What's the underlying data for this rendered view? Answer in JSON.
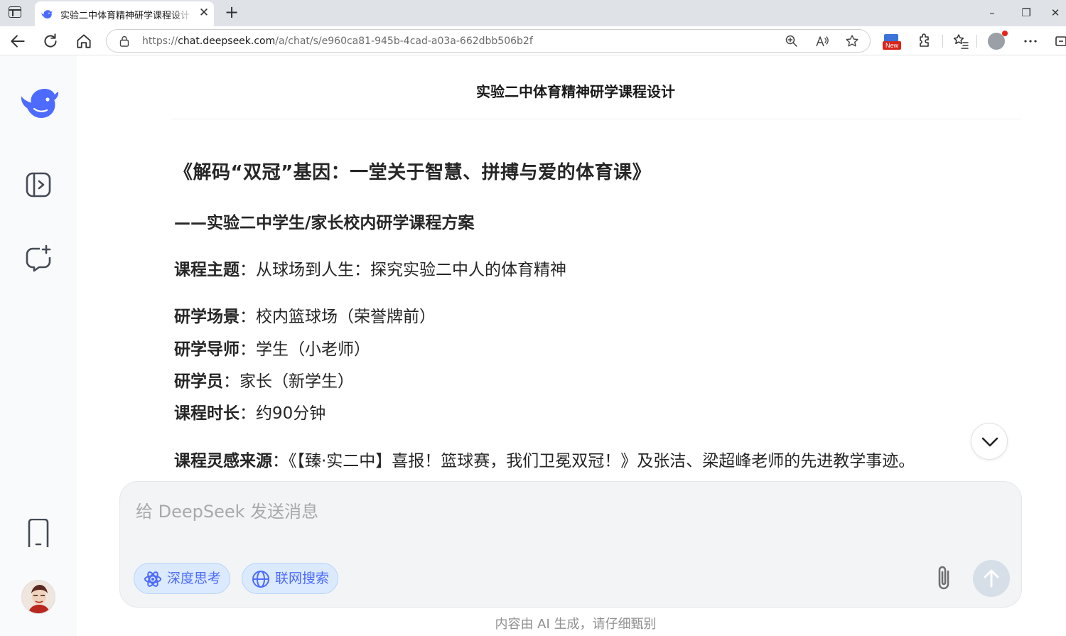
{
  "browser": {
    "tab_title": "实验二中体育精神研学课程设计 - DeepSeek",
    "new_tab_symbol": "+",
    "url_prefix": "https://",
    "url_host": "chat.deepseek.com",
    "url_path": "/a/chat/s/e960ca81-945b-4cad-a03a-662dbb506b2f",
    "new_badge": "New",
    "window_controls": [
      "–",
      "❐",
      "✕"
    ]
  },
  "chat": {
    "title": "实验二中体育精神研学课程设计"
  },
  "article": {
    "heading": "《解码“双冠”基因：一堂关于智慧、拼搏与爱的体育课》",
    "subheading": "——实验二中学生/家长校内研学课程方案",
    "rows": [
      {
        "label": "课程主题",
        "value": "：从球场到人生：探究实验二中人的体育精神"
      },
      {
        "label": "研学场景",
        "value": "：校内篮球场（荣誉牌前）"
      },
      {
        "label": "研学导师",
        "value": "：学生（小老师）"
      },
      {
        "label": "研学员",
        "value": "：家长（新学生）"
      },
      {
        "label": "课程时长",
        "value": "：约90分钟"
      },
      {
        "label": "课程灵感来源",
        "value": "：《【臻·实二中】喜报！篮球赛，我们卫冕双冠！》及张洁、梁超峰老师的先进教学事迹。"
      }
    ]
  },
  "composer": {
    "placeholder": "给 DeepSeek 发送消息",
    "deep_think_label": "深度思考",
    "web_search_label": "联网搜索"
  },
  "footer": {
    "disclaimer": "内容由 AI 生成，请仔细甄别"
  },
  "colors": {
    "accent": "#4d6bfe",
    "pill_bg": "#dbeafe",
    "send_disabled": "#d6dee8"
  }
}
